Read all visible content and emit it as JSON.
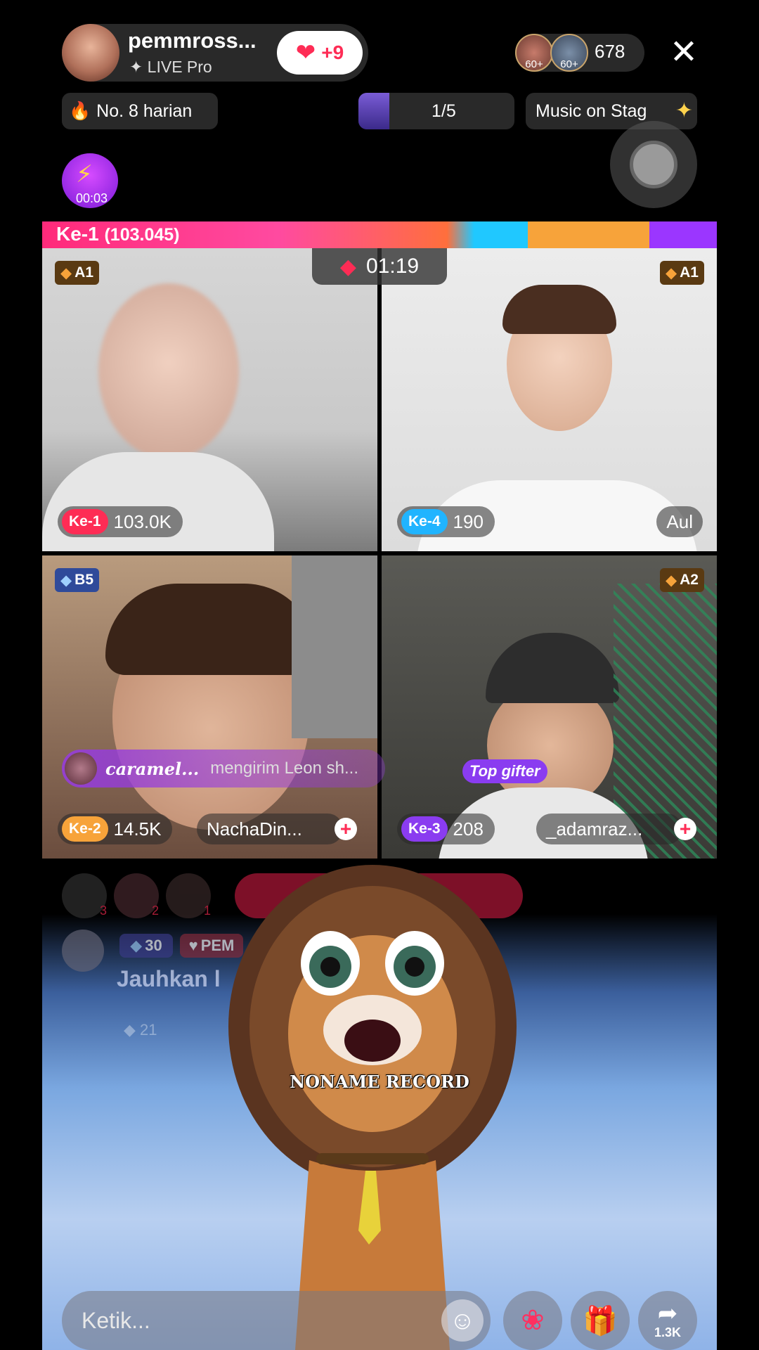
{
  "host": {
    "name": "pemmross...",
    "subtitle": "LIVE Pro",
    "follow_label": "+9"
  },
  "viewers": {
    "badge1": "60+",
    "badge2": "60+",
    "count": "678"
  },
  "chips": {
    "daily_rank": "No. 8 harian",
    "page": "1/5",
    "music": "Music on Stag"
  },
  "timer_badge": "00:03",
  "battle": {
    "label": "Ke-1",
    "score": "(103.045)",
    "timer": "01:19"
  },
  "cells": [
    {
      "rank_badge": "A1",
      "ke": "Ke-1",
      "score": "103.0K",
      "name": ""
    },
    {
      "rank_badge": "A1",
      "ke": "Ke-4",
      "score": "190",
      "name": "Aul"
    },
    {
      "rank_badge": "B5",
      "ke": "Ke-2",
      "score": "14.5K",
      "name": "NachaDin..."
    },
    {
      "rank_badge": "A2",
      "ke": "Ke-3",
      "score": "208",
      "name": "_adamraz..."
    }
  ],
  "gift_notice": {
    "user": "caramel...",
    "text": "mengirim Leon sh..."
  },
  "top_gifter": "Top gifter",
  "ranking_avatars": [
    "3",
    "2",
    "1"
  ],
  "chat": {
    "level": "30",
    "tag": "PEM",
    "message": "Jauhkan l",
    "level2": "21"
  },
  "watermark": "NONAME RECORD",
  "bottom": {
    "input_placeholder": "Ketik...",
    "share_count": "1.3K"
  },
  "colors": {
    "accent": "#fe2c55",
    "ke1": "#fe2c55",
    "ke2": "#f7a33a",
    "ke3": "#8a3cf0",
    "ke4": "#20b4ff"
  }
}
